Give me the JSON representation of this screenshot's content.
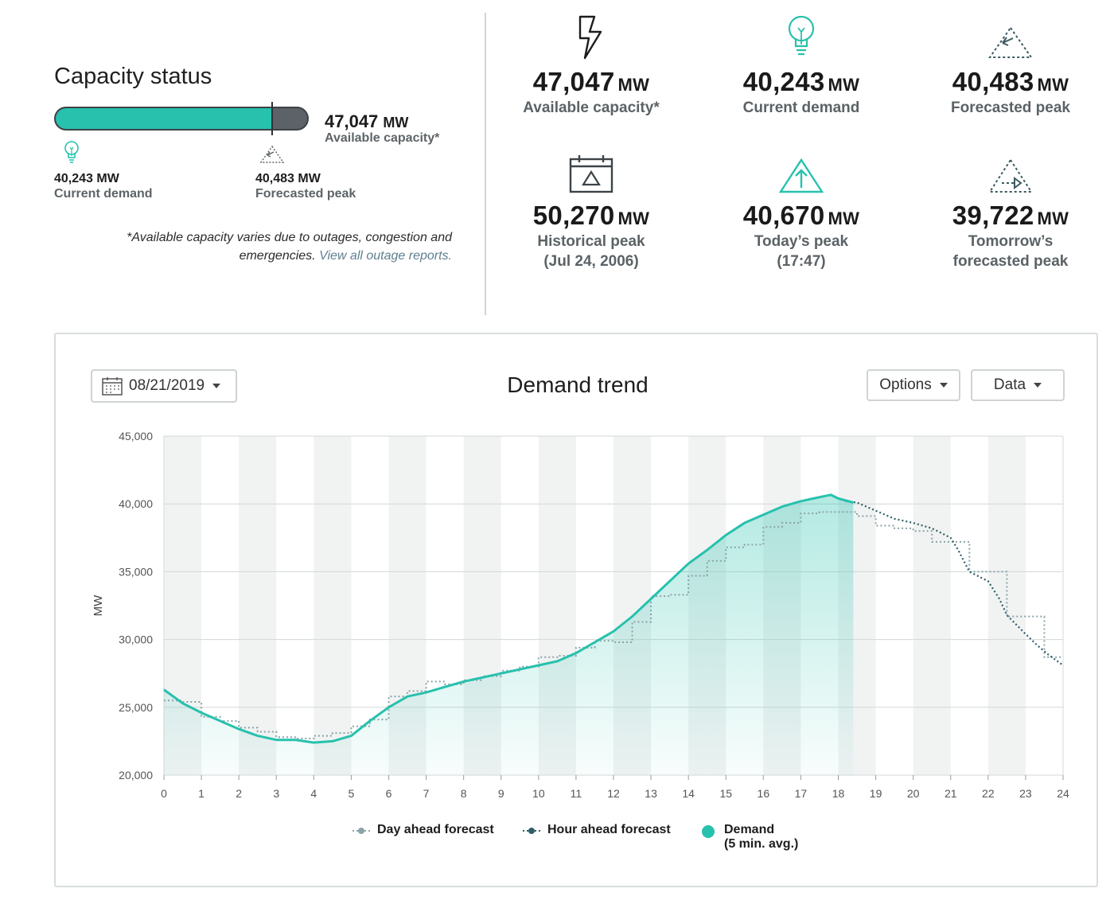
{
  "capacity": {
    "title": "Capacity status",
    "value": "47,047",
    "unit": "MW",
    "label": "Available capacity*",
    "fill_fraction": 0.86,
    "current_demand_value": "40,243 MW",
    "current_demand_label": "Current demand",
    "forecasted_peak_value": "40,483 MW",
    "forecasted_peak_label": "Forecasted peak",
    "note_text": "*Available capacity varies due to outages, congestion and emergencies.",
    "note_link": "View all outage reports."
  },
  "stats": [
    {
      "icon": "lightning-icon",
      "value": "47,047",
      "unit": "MW",
      "label": "Available capacity*"
    },
    {
      "icon": "lightbulb-icon",
      "value": "40,243",
      "unit": "MW",
      "label": "Current demand"
    },
    {
      "icon": "forecast-triangle-icon",
      "value": "40,483",
      "unit": "MW",
      "label": "Forecasted peak"
    },
    {
      "icon": "calendar-peak-icon",
      "value": "50,270",
      "unit": "MW",
      "label": "Historical peak",
      "label2": "(Jul 24, 2006)"
    },
    {
      "icon": "peak-arrow-icon",
      "value": "40,670",
      "unit": "MW",
      "label": "Today’s peak",
      "label2": "(17:47)"
    },
    {
      "icon": "tomorrow-forecast-icon",
      "value": "39,722",
      "unit": "MW",
      "label": "Tomorrow’s",
      "label2": "forecasted peak"
    }
  ],
  "colors": {
    "accent": "#27c1ad",
    "dark": "#2f5e66",
    "grey": "#8aa3a8"
  },
  "panel": {
    "date": "08/21/2019",
    "title": "Demand trend",
    "options_label": "Options",
    "data_label": "Data",
    "legend": {
      "day_ahead": "Day ahead forecast",
      "hour_ahead": "Hour ahead forecast",
      "demand": "Demand",
      "demand_sub": "(5 min. avg.)"
    }
  },
  "chart_data": {
    "type": "line",
    "title": "Demand trend",
    "xlabel": "",
    "ylabel": "MW",
    "xlim": [
      0,
      24
    ],
    "ylim": [
      20000,
      45000
    ],
    "x_ticks": [
      "0",
      "1",
      "2",
      "3",
      "4",
      "5",
      "6",
      "7",
      "8",
      "9",
      "10",
      "11",
      "12",
      "13",
      "14",
      "15",
      "16",
      "17",
      "18",
      "19",
      "20",
      "21",
      "22",
      "23",
      "24"
    ],
    "y_ticks": [
      "20,000",
      "25,000",
      "30,000",
      "35,000",
      "40,000",
      "45,000"
    ],
    "grid": true,
    "legend_position": "bottom",
    "series": [
      {
        "name": "Day ahead forecast",
        "style": "step-dotted",
        "x": [
          0,
          0.5,
          1,
          1.5,
          2,
          2.5,
          3,
          3.5,
          4,
          4.5,
          5,
          5.5,
          6,
          6.5,
          7,
          7.5,
          8,
          8.5,
          9,
          9.5,
          10,
          10.5,
          11,
          11.5,
          12,
          12.5,
          13,
          13.5,
          14,
          14.5,
          15,
          15.5,
          16,
          16.5,
          17,
          17.5,
          18,
          18.5,
          19,
          19.5,
          20,
          20.5,
          21,
          21.5,
          22,
          22.5,
          23,
          23.5,
          24
        ],
        "values": [
          25500,
          25400,
          24300,
          24000,
          23500,
          23200,
          22800,
          22700,
          22900,
          23100,
          23600,
          24100,
          25800,
          26200,
          26900,
          26700,
          27000,
          27300,
          27700,
          28000,
          28700,
          28800,
          29400,
          29900,
          29800,
          31300,
          33200,
          33300,
          34700,
          35800,
          36800,
          37000,
          38300,
          38600,
          39300,
          39400,
          39400,
          39100,
          38400,
          38200,
          38000,
          37200,
          37200,
          35000,
          35000,
          31700,
          31700,
          28700,
          28700
        ]
      },
      {
        "name": "Hour ahead forecast",
        "style": "dotted",
        "x": [
          18.2,
          18.5,
          19,
          19.5,
          20,
          20.5,
          21,
          21.2,
          21.5,
          22,
          22.3,
          22.5,
          23,
          23.3,
          23.6,
          24
        ],
        "values": [
          40200,
          40100,
          39500,
          38900,
          38600,
          38200,
          37500,
          36600,
          35000,
          34300,
          33000,
          31800,
          30400,
          29600,
          28900,
          28100
        ]
      },
      {
        "name": "Demand",
        "sub": "(5 min. avg.)",
        "style": "solid-filled",
        "x": [
          0,
          0.5,
          1,
          1.5,
          2,
          2.5,
          3,
          3.5,
          4,
          4.5,
          5,
          5.5,
          6,
          6.5,
          7,
          7.5,
          8,
          8.5,
          9,
          9.5,
          10,
          10.5,
          11,
          11.5,
          12,
          12.5,
          13,
          13.5,
          14,
          14.5,
          15,
          15.5,
          16,
          16.5,
          17,
          17.5,
          17.8,
          18,
          18.4
        ],
        "values": [
          26300,
          25300,
          24600,
          24000,
          23400,
          22900,
          22600,
          22600,
          22400,
          22500,
          22900,
          24000,
          25000,
          25800,
          26100,
          26500,
          26900,
          27200,
          27500,
          27800,
          28100,
          28400,
          29000,
          29800,
          30600,
          31700,
          33000,
          34300,
          35600,
          36600,
          37700,
          38600,
          39200,
          39800,
          40200,
          40500,
          40670,
          40400,
          40100
        ]
      }
    ]
  }
}
